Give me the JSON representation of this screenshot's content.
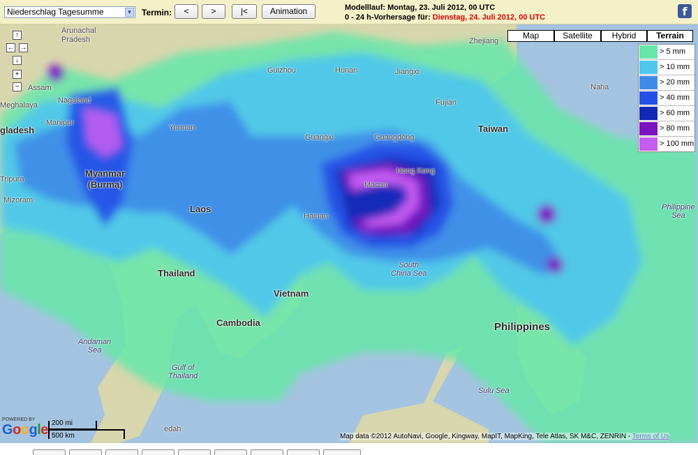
{
  "toolbar": {
    "product_select": "Niederschlag Tagesumme",
    "termin_label": "Termin:",
    "prev_label": "<",
    "next_label": ">",
    "first_label": "|<",
    "animation_label": "Animation",
    "run_prefix": "Modelllauf: ",
    "run_value": "Montag, 23. Juli 2012, 00 UTC",
    "forecast_prefix": "0 - 24 h-Vorhersage für: ",
    "forecast_value": "Dienstag, 24. Juli 2012, 00 UTC",
    "facebook_glyph": "f"
  },
  "map_types": [
    "Map",
    "Satellite",
    "Hybrid",
    "Terrain"
  ],
  "map_type_selected": "Terrain",
  "legend": [
    {
      "label": "> 5 mm",
      "color": "#66e6a8"
    },
    {
      "label": "> 10 mm",
      "color": "#4ec6ee"
    },
    {
      "label": "> 20 mm",
      "color": "#3f8ae8"
    },
    {
      "label": "> 40 mm",
      "color": "#2550e6"
    },
    {
      "label": "> 60 mm",
      "color": "#1328b4"
    },
    {
      "label": "> 80 mm",
      "color": "#7a12c2"
    },
    {
      "label": "> 100 mm",
      "color": "#c45cf2"
    }
  ],
  "nav": {
    "up": "↑",
    "left": "←",
    "right": "→",
    "down": "↓",
    "zoom_in": "+",
    "zoom_out": "−"
  },
  "places": {
    "arunachal": "Arunachal\nPradesh",
    "assam": "Assam",
    "nagaland": "Nagaland",
    "meghalaya": "Meghalaya",
    "manipur": "Manipur",
    "bangladesh": "gladesh",
    "tripura": "Tripura",
    "mizoram": "Mizoram",
    "myanmar": "Myanmar\n(Burma)",
    "yunnan": "Yunnan",
    "guizhou": "Guizhou",
    "hunan": "Hunan",
    "jiangxi": "Jiangxi",
    "zhejiang": "Zhejiang",
    "fujian": "Fujian",
    "naha": "Naha",
    "taiwan": "Taiwan",
    "guangxi": "Guangxi",
    "guangdong": "Guangdong",
    "hongkong": "Hong Kong",
    "macau": "Macau",
    "hainan": "Hainan",
    "laos": "Laos",
    "thailand": "Thailand",
    "vietnam": "Vietnam",
    "cambodia": "Cambodia",
    "scs": "South\nChina Sea",
    "philippine_sea": "Philippine\nSea",
    "philippines": "Philippines",
    "andaman": "Andaman\nSea",
    "gulf_thailand": "Gulf of\nThailand",
    "sulu": "Sulu Sea",
    "kedah": "edah"
  },
  "google": {
    "powered": "POWERED BY",
    "logo": "Google"
  },
  "scale": {
    "mi": "200 mi",
    "km": "500 km"
  },
  "attribution": "Map data ©2012 AutoNavi, Google, Kingway, MapIT, MapKing, Tele Atlas, SK M&C, ZENRIN - ",
  "terms": "Terms of Us"
}
